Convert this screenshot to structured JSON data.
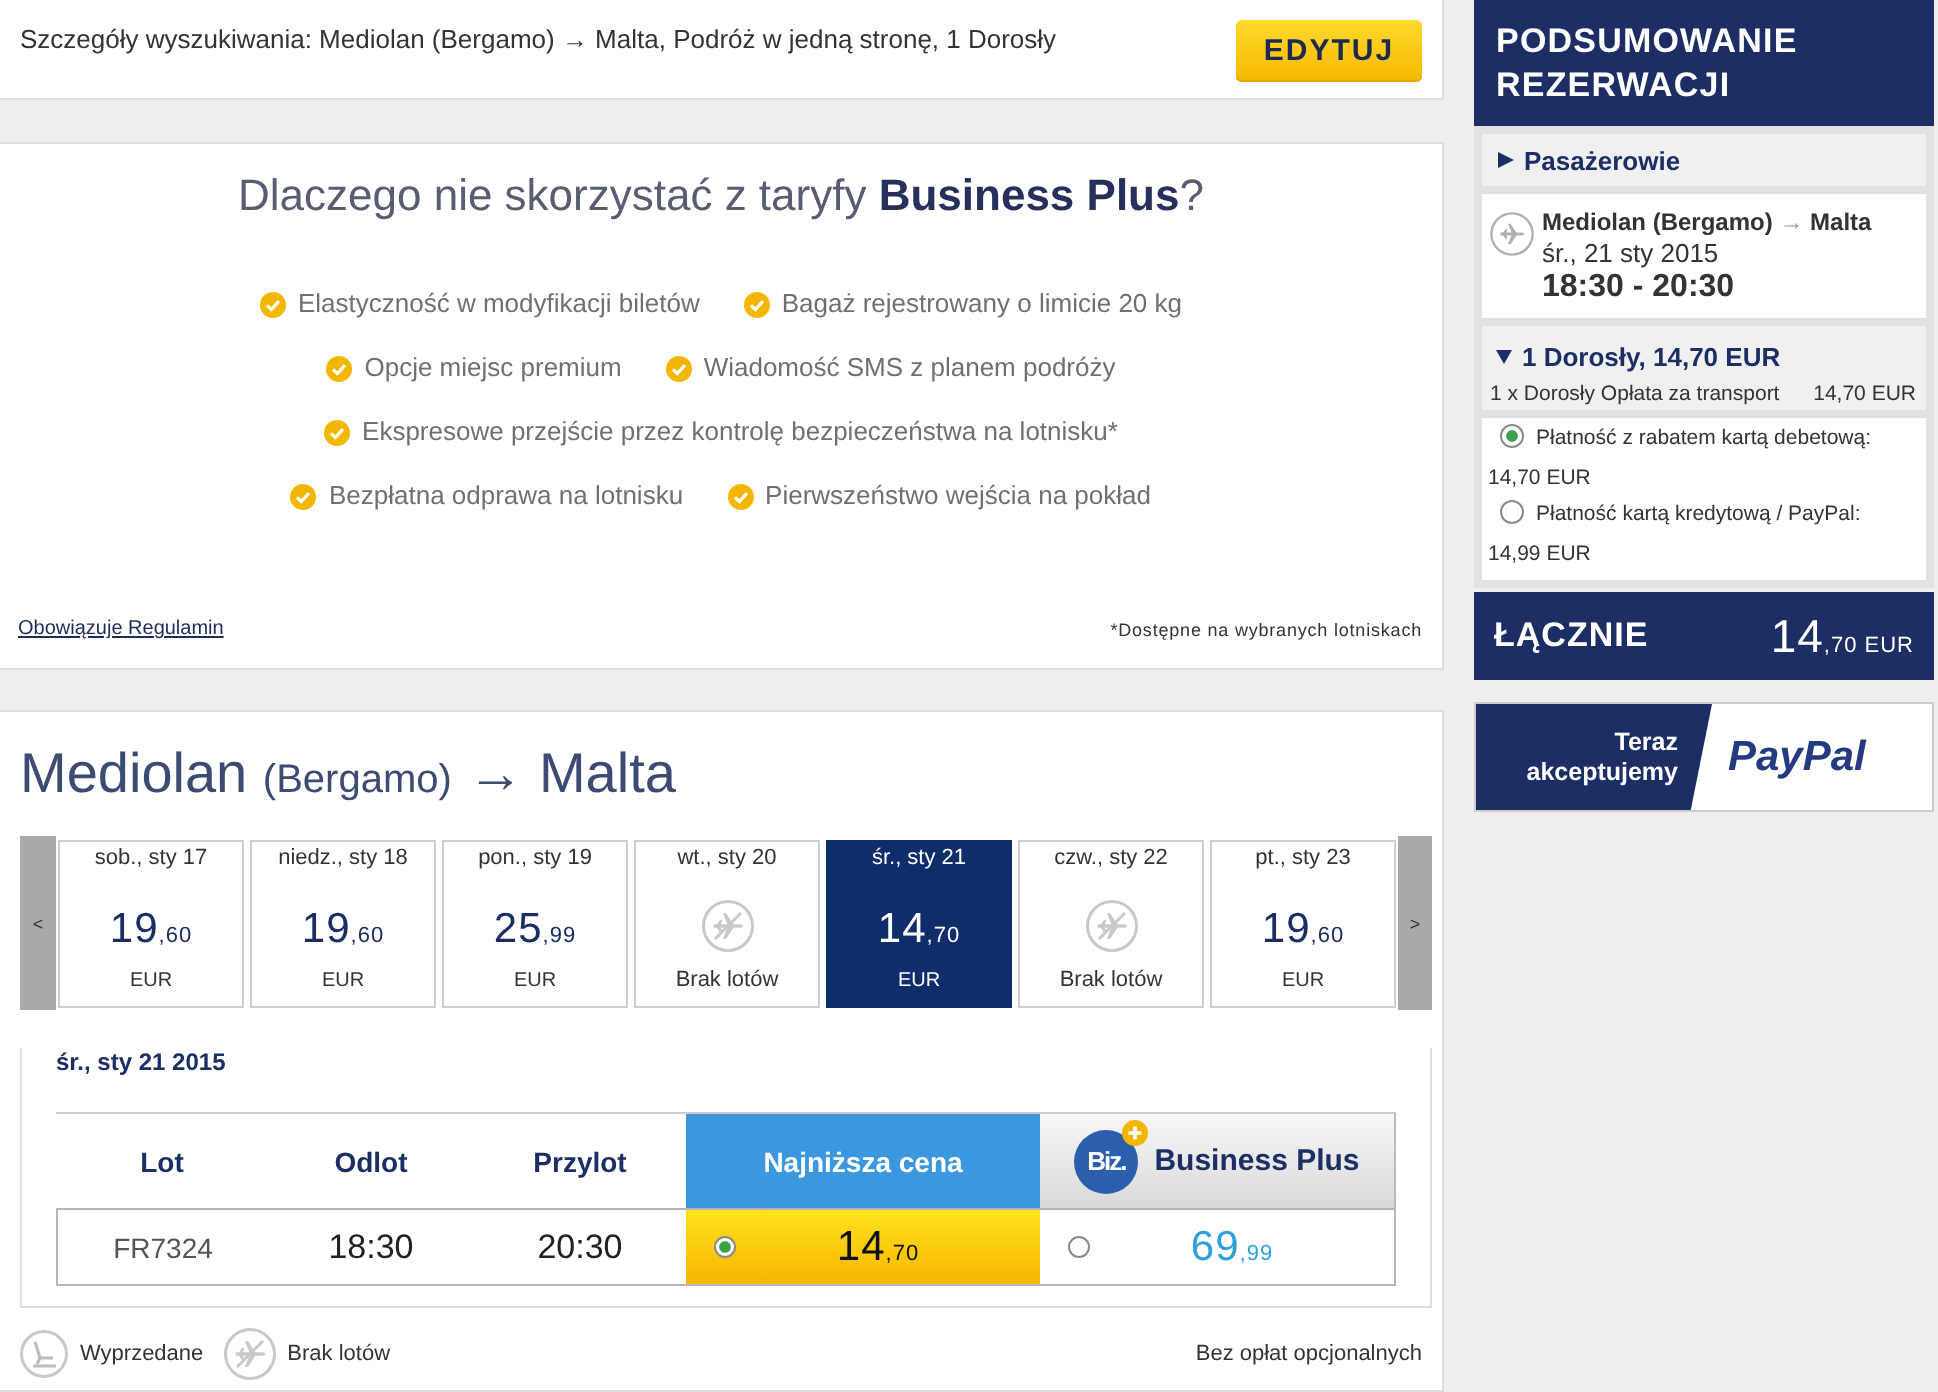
{
  "search_summary": {
    "text": "Szczegóły wyszukiwania: Mediolan (Bergamo) → Malta, Podróż w jedną stronę, 1 Dorosły",
    "edit_button": "EDYTUJ"
  },
  "business_plus_promo": {
    "title": "Dlaczego nie skorzystać z taryfy **Business Plus**?",
    "feature_rows": [
      {
        "features": [
          "Elastyczność w modyfikacji biletów",
          "Bagaż rejestrowany o limicie 20 kg"
        ]
      },
      {
        "features": [
          "Opcje miejsc premium",
          "Wiadomość SMS z planem podróży"
        ]
      },
      {
        "features": [
          "Ekspresowe przejście przez kontrolę bezpieczeństwa na lotnisku*"
        ]
      },
      {
        "features": [
          "Bezpłatna odprawa na lotnisku",
          "Pierwszeństwo wejścia na pokład"
        ]
      }
    ],
    "terms_link": "Obowiązuje Regulamin",
    "footnote": "*Dostępne na wybranych lotniskach"
  },
  "flight_search": {
    "route": {
      "origin": "Mediolan",
      "origin_airport": "(Bergamo)",
      "arrow": "→",
      "destination": "Malta"
    },
    "date_carousel": {
      "prev": "<",
      "next": ">",
      "days": [
        {
          "date": "sob., sty 17",
          "kind": "price",
          "selected": false,
          "price_whole": "19",
          "price_decimal": ",60",
          "currency": "EUR"
        },
        {
          "date": "niedz., sty 18",
          "kind": "price",
          "selected": false,
          "price_whole": "19",
          "price_decimal": ",60",
          "currency": "EUR"
        },
        {
          "date": "pon., sty 19",
          "kind": "price",
          "selected": false,
          "price_whole": "25",
          "price_decimal": ",99",
          "currency": "EUR"
        },
        {
          "date": "wt., sty 20",
          "kind": "no_flights",
          "selected": false,
          "label": "Brak lotów"
        },
        {
          "date": "śr., sty 21",
          "kind": "price",
          "selected": true,
          "price_whole": "14",
          "price_decimal": ",70",
          "currency": "EUR"
        },
        {
          "date": "czw., sty 22",
          "kind": "no_flights",
          "selected": false,
          "label": "Brak lotów"
        },
        {
          "date": "pt., sty 23",
          "kind": "price",
          "selected": false,
          "price_whole": "19",
          "price_decimal": ",60",
          "currency": "EUR"
        }
      ]
    },
    "selected_date": "śr., sty 21 2015",
    "fare_table": {
      "columns": [
        {
          "label": "Lot",
          "kind": "plain"
        },
        {
          "label": "Odlot",
          "kind": "plain"
        },
        {
          "label": "Przylot",
          "kind": "plain"
        },
        {
          "label": "Najniższa cena",
          "kind": "lowest"
        },
        {
          "label": "Business Plus",
          "kind": "business",
          "logo": "Biz."
        }
      ],
      "rows": [
        {
          "flight": "FR7324",
          "departure": "18:30",
          "arrival": "20:30",
          "fares": [
            {
              "kind": "lowest",
              "selected": true,
              "price_whole": "14",
              "price_decimal": ",70"
            },
            {
              "kind": "business",
              "selected": false,
              "price_whole": "69",
              "price_decimal": ",99"
            }
          ]
        }
      ]
    },
    "legend": [
      {
        "kind": "sold_out",
        "label": "Wyprzedane"
      },
      {
        "kind": "no_flights",
        "label": "Brak lotów"
      }
    ],
    "note": "Bez opłat opcjonalnych"
  },
  "booking_summary": {
    "title": "PODSUMOWANIE REZERWACJI",
    "passengers_section": {
      "label": "Pasażerowie",
      "expanded": false
    },
    "flight": {
      "route_from": "Mediolan (Bergamo)",
      "arrow": "→",
      "route_to": "Malta",
      "date": "śr., 21 sty 2015",
      "time": "18:30 - 20:30"
    },
    "passenger_group": {
      "label": "1 Dorosły, 14,70 EUR",
      "expanded": true,
      "lines": [
        {
          "description": "1 x Dorosły Opłata za transport",
          "amount": "14,70 EUR"
        }
      ]
    },
    "payment_options": [
      {
        "label": "Płatność z rabatem kartą debetową:",
        "amount": "14,70 EUR",
        "selected": true
      },
      {
        "label": "Płatność kartą kredytową / PayPal:",
        "amount": "14,99 EUR",
        "selected": false
      }
    ],
    "total": {
      "label": "ŁĄCZNIE",
      "amount_whole": "14",
      "amount_decimal": ",70 EUR"
    }
  },
  "paypal_banner": {
    "text": "Teraz akceptujemy",
    "logo": "PayPal"
  }
}
